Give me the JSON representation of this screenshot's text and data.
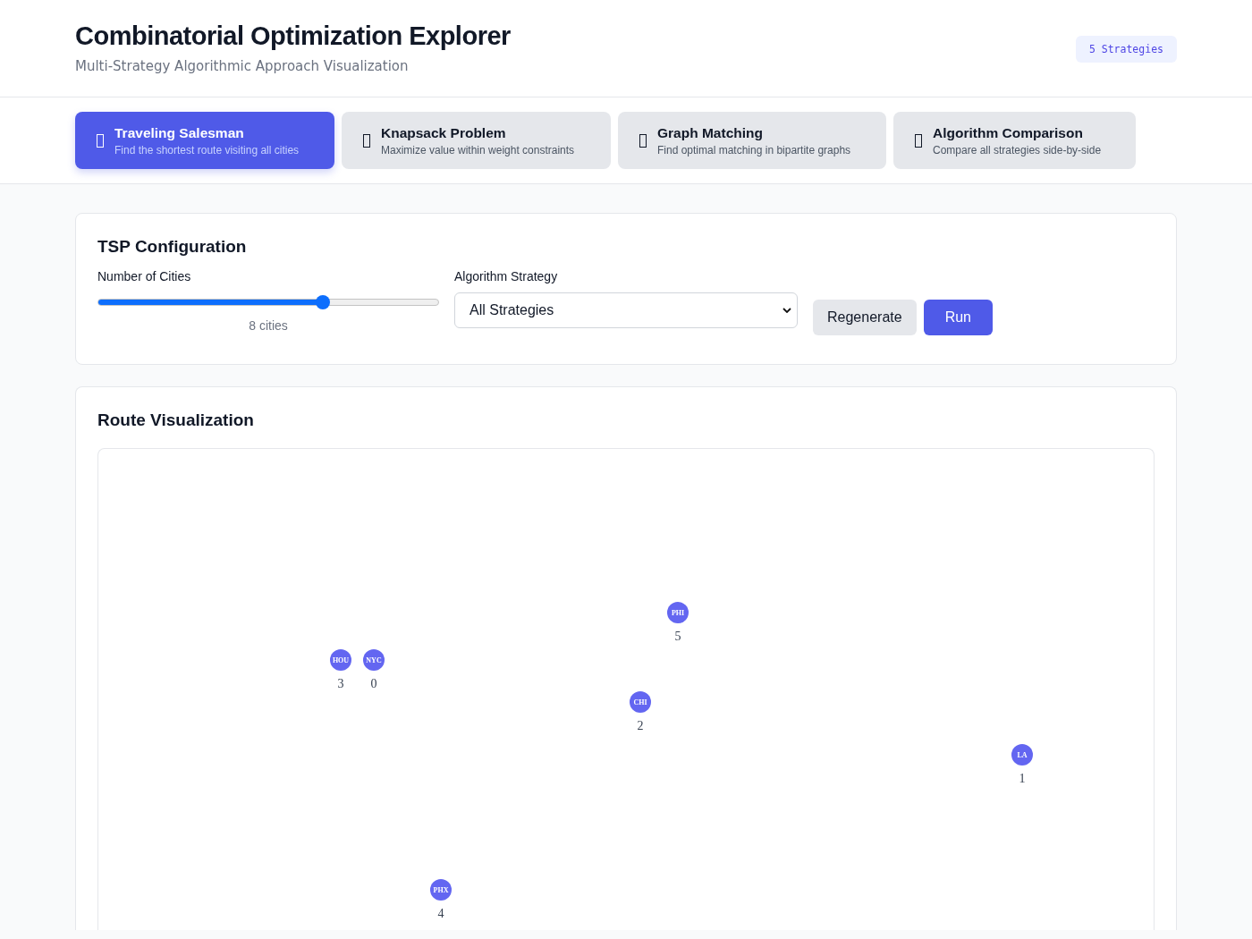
{
  "header": {
    "title": "Combinatorial Optimization Explorer",
    "subtitle": "Multi-Strategy Algorithmic Approach Visualization",
    "badge": "5 Strategies"
  },
  "tabs": [
    {
      "title": "Traveling Salesman",
      "description": "Find the shortest route visiting all cities",
      "selected": true
    },
    {
      "title": "Knapsack Problem",
      "description": "Maximize value within weight constraints",
      "selected": false
    },
    {
      "title": "Graph Matching",
      "description": "Find optimal matching in bipartite graphs",
      "selected": false
    },
    {
      "title": "Algorithm Comparison",
      "description": "Compare all strategies side-by-side",
      "selected": false
    }
  ],
  "config": {
    "title": "TSP Configuration",
    "cities_label": "Number of Cities",
    "cities_slider": {
      "level": 0.66
    },
    "cities_reading": "8 cities",
    "strategy_label": "Algorithm Strategy",
    "strategy_value": "All Strategies",
    "buttons": [
      {
        "label": "Regenerate",
        "kind": "secondary"
      },
      {
        "label": "Run",
        "kind": "primary"
      }
    ]
  },
  "visualization": {
    "title": "Route Visualization",
    "cities": [
      {
        "code": "NYC",
        "index": "0"
      },
      {
        "code": "LA",
        "index": "1"
      },
      {
        "code": "CHI",
        "index": "2"
      },
      {
        "code": "HOU",
        "index": "3"
      },
      {
        "code": "PHX",
        "index": "4"
      },
      {
        "code": "PHI",
        "index": "5"
      }
    ]
  }
}
